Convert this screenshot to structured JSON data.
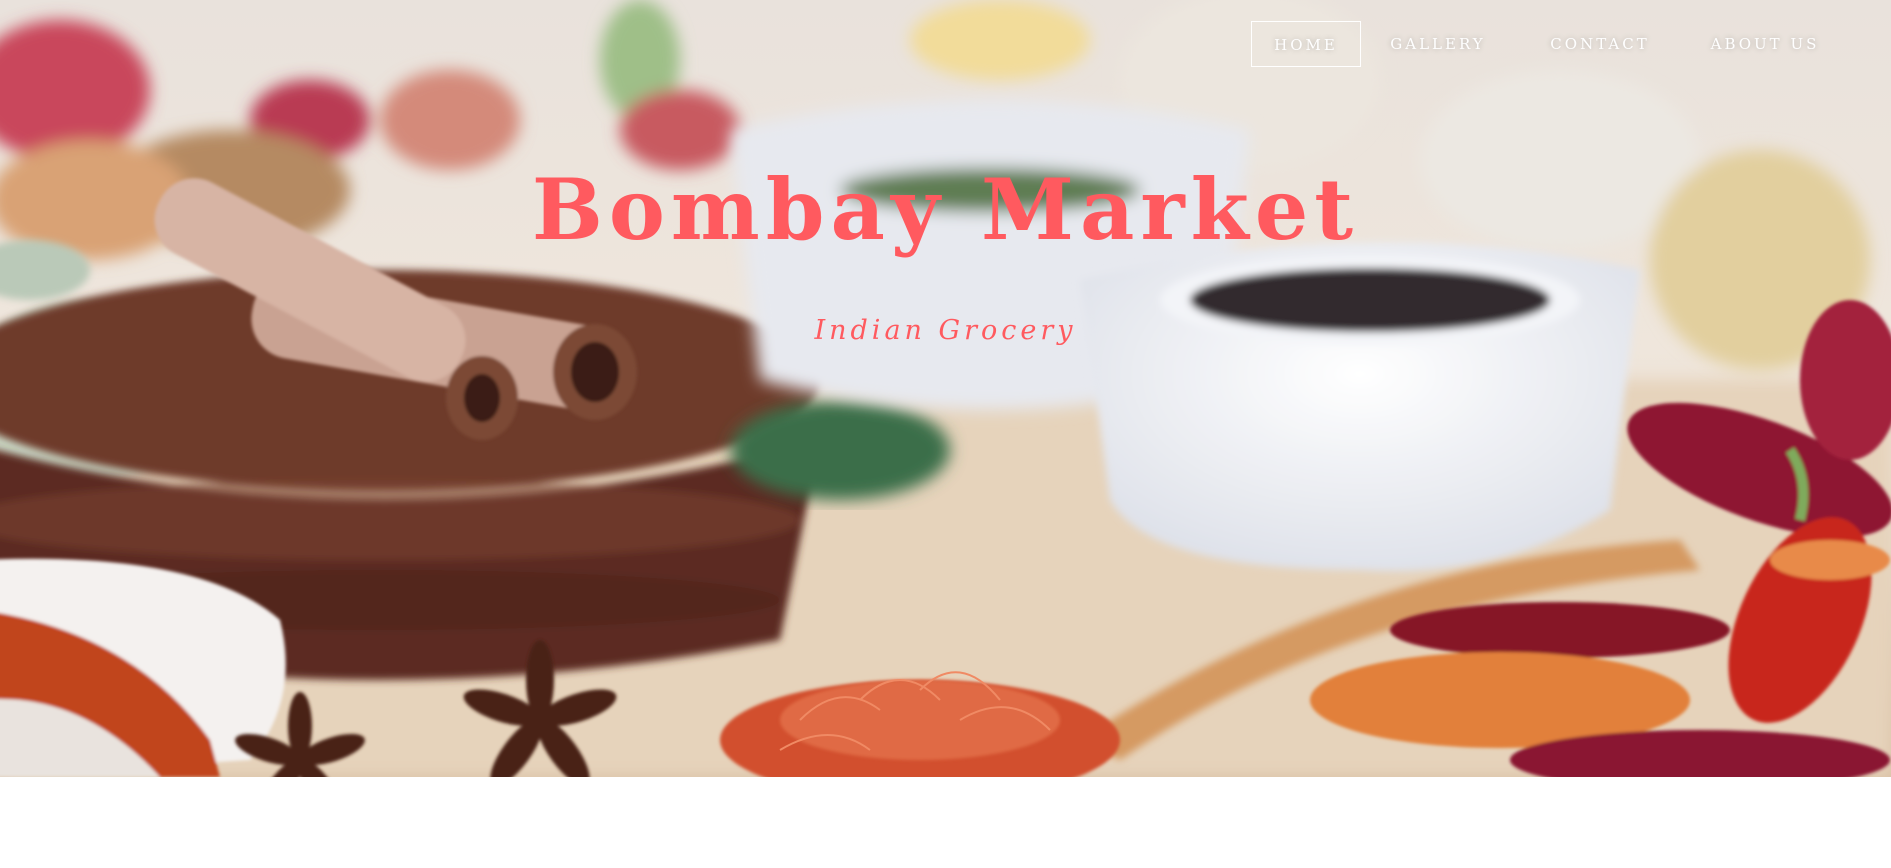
{
  "nav": {
    "items": [
      {
        "label": "HOME",
        "active": true
      },
      {
        "label": "GALLERY",
        "active": false
      },
      {
        "label": "CONTACT",
        "active": false
      },
      {
        "label": "ABOUT US",
        "active": false
      }
    ]
  },
  "hero": {
    "title": "Bombay Market",
    "subtitle": "Indian Grocery",
    "accent_color": "#ff5a5f"
  }
}
